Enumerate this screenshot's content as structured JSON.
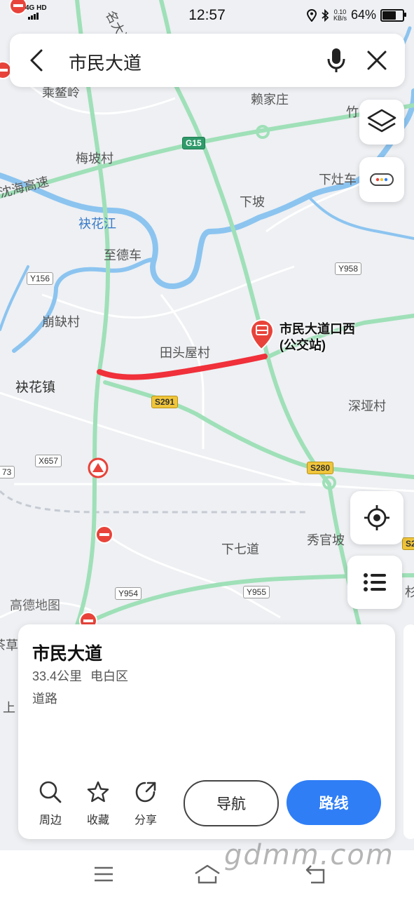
{
  "status": {
    "network": "4G HD",
    "time": "12:57",
    "net_speed_value": "0.10",
    "net_speed_unit": "KB/s",
    "battery": "64%"
  },
  "search": {
    "query": "市民大道"
  },
  "map": {
    "labels": [
      {
        "text": "乘鳌岭"
      },
      {
        "text": "赖家庄"
      },
      {
        "text": "竹"
      },
      {
        "text": "梅坡村"
      },
      {
        "text": "下灶车"
      },
      {
        "text": "沈海高速"
      },
      {
        "text": "下坡"
      },
      {
        "text": "袂花江"
      },
      {
        "text": "至德车"
      },
      {
        "text": "崩缺村"
      },
      {
        "text": "田头屋村"
      },
      {
        "text": "袂花镇"
      },
      {
        "text": "深垭村"
      },
      {
        "text": "下七道"
      },
      {
        "text": "秀官坡"
      },
      {
        "text": "高德地图"
      },
      {
        "text": "杉"
      },
      {
        "text": "茶草"
      },
      {
        "text": "上"
      },
      {
        "text": "名大道"
      }
    ],
    "road_badges": [
      {
        "text": "G15",
        "kind": "g"
      },
      {
        "text": "Y958",
        "kind": "y"
      },
      {
        "text": "Y156",
        "kind": "y"
      },
      {
        "text": "S291",
        "kind": "s"
      },
      {
        "text": "X657",
        "kind": "y"
      },
      {
        "text": "73",
        "kind": "y"
      },
      {
        "text": "S280",
        "kind": "s"
      },
      {
        "text": "Y954",
        "kind": "y"
      },
      {
        "text": "Y955",
        "kind": "y"
      },
      {
        "text": "S2",
        "kind": "s"
      }
    ],
    "poi": {
      "name_line1": "市民大道口西",
      "name_line2": "(公交站)"
    }
  },
  "card": {
    "title": "市民大道",
    "distance": "33.4公里",
    "district": "电白区",
    "type": "道路",
    "actions": [
      {
        "label": "周边",
        "icon": "search-icon"
      },
      {
        "label": "收藏",
        "icon": "star-icon"
      },
      {
        "label": "分享",
        "icon": "share-icon"
      }
    ],
    "nav_label": "导航",
    "route_label": "路线"
  },
  "watermark": "gdmm.com",
  "colors": {
    "route_highlight": "#f0303a",
    "primary_blue": "#2f7ef6",
    "river": "#8cc4f0",
    "highway": "#9fe0b8",
    "poi_red": "#e8433a"
  }
}
